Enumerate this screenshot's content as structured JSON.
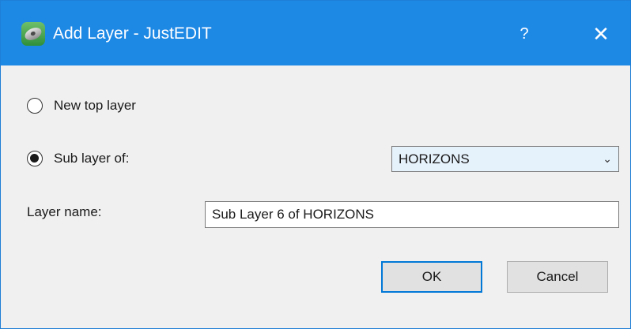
{
  "window": {
    "title": "Add Layer - JustEDIT",
    "help_label": "?",
    "close_label": "✕",
    "icon": "justedit-app-icon"
  },
  "options": {
    "new_top_layer": {
      "label": "New top layer",
      "checked": false
    },
    "sub_layer_of": {
      "label": "Sub layer of:",
      "checked": true
    }
  },
  "parent_layer": {
    "selected": "HORIZONS",
    "arrow_icon": "chevron-down-icon"
  },
  "layer_name": {
    "label": "Layer name:",
    "value": "Sub Layer 6 of HORIZONS"
  },
  "buttons": {
    "ok_label": "OK",
    "cancel_label": "Cancel"
  },
  "colors": {
    "titlebar": "#1e88e5",
    "dialog_bg": "#f0f0f0",
    "default_button_border": "#0078d7"
  }
}
